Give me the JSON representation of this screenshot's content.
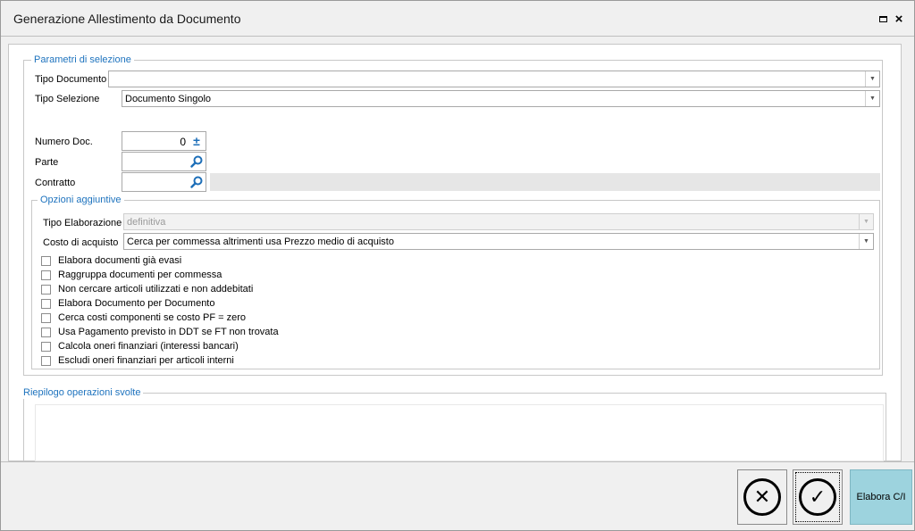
{
  "window": {
    "title": "Generazione Allestimento da Documento",
    "maximize_icon": "maximize-icon",
    "close_glyph": "×"
  },
  "selection": {
    "legend": "Parametri di selezione",
    "tipo_documento": {
      "label": "Tipo Documento",
      "value": ""
    },
    "tipo_selezione": {
      "label": "Tipo Selezione",
      "value": "Documento Singolo"
    },
    "numero_doc": {
      "label": "Numero Doc.",
      "value": "0",
      "spin_glyph": "±"
    },
    "parte": {
      "label": "Parte",
      "value": ""
    },
    "contratto": {
      "label": "Contratto",
      "value": ""
    }
  },
  "options": {
    "legend": "Opzioni aggiuntive",
    "tipo_elaborazione": {
      "label": "Tipo Elaborazione",
      "value": "definitiva"
    },
    "costo_acquisto": {
      "label": "Costo di acquisto",
      "value": "Cerca per commessa altrimenti usa Prezzo medio di acquisto"
    },
    "checkboxes": [
      {
        "label": "Elabora documenti già evasi",
        "checked": false
      },
      {
        "label": "Raggruppa documenti per commessa",
        "checked": false
      },
      {
        "label": "Non cercare articoli utilizzati e non addebitati",
        "checked": false
      },
      {
        "label": "Elabora Documento per Documento",
        "checked": false
      },
      {
        "label": "Cerca costi componenti se costo PF = zero",
        "checked": false
      },
      {
        "label": "Usa Pagamento previsto in DDT se FT non trovata",
        "checked": false
      },
      {
        "label": "Calcola oneri finanziari (interessi bancari)",
        "checked": false
      },
      {
        "label": "Escludi oneri finanziari per articoli interni",
        "checked": false
      }
    ]
  },
  "summary": {
    "legend": "Riepilogo operazioni svolte"
  },
  "footer": {
    "cancel_glyph": "✕",
    "confirm_glyph": "✓",
    "elabora_label": "Elabora C/I"
  },
  "colors": {
    "accent": "#1e73be",
    "primary_button": "#9dd3de"
  }
}
